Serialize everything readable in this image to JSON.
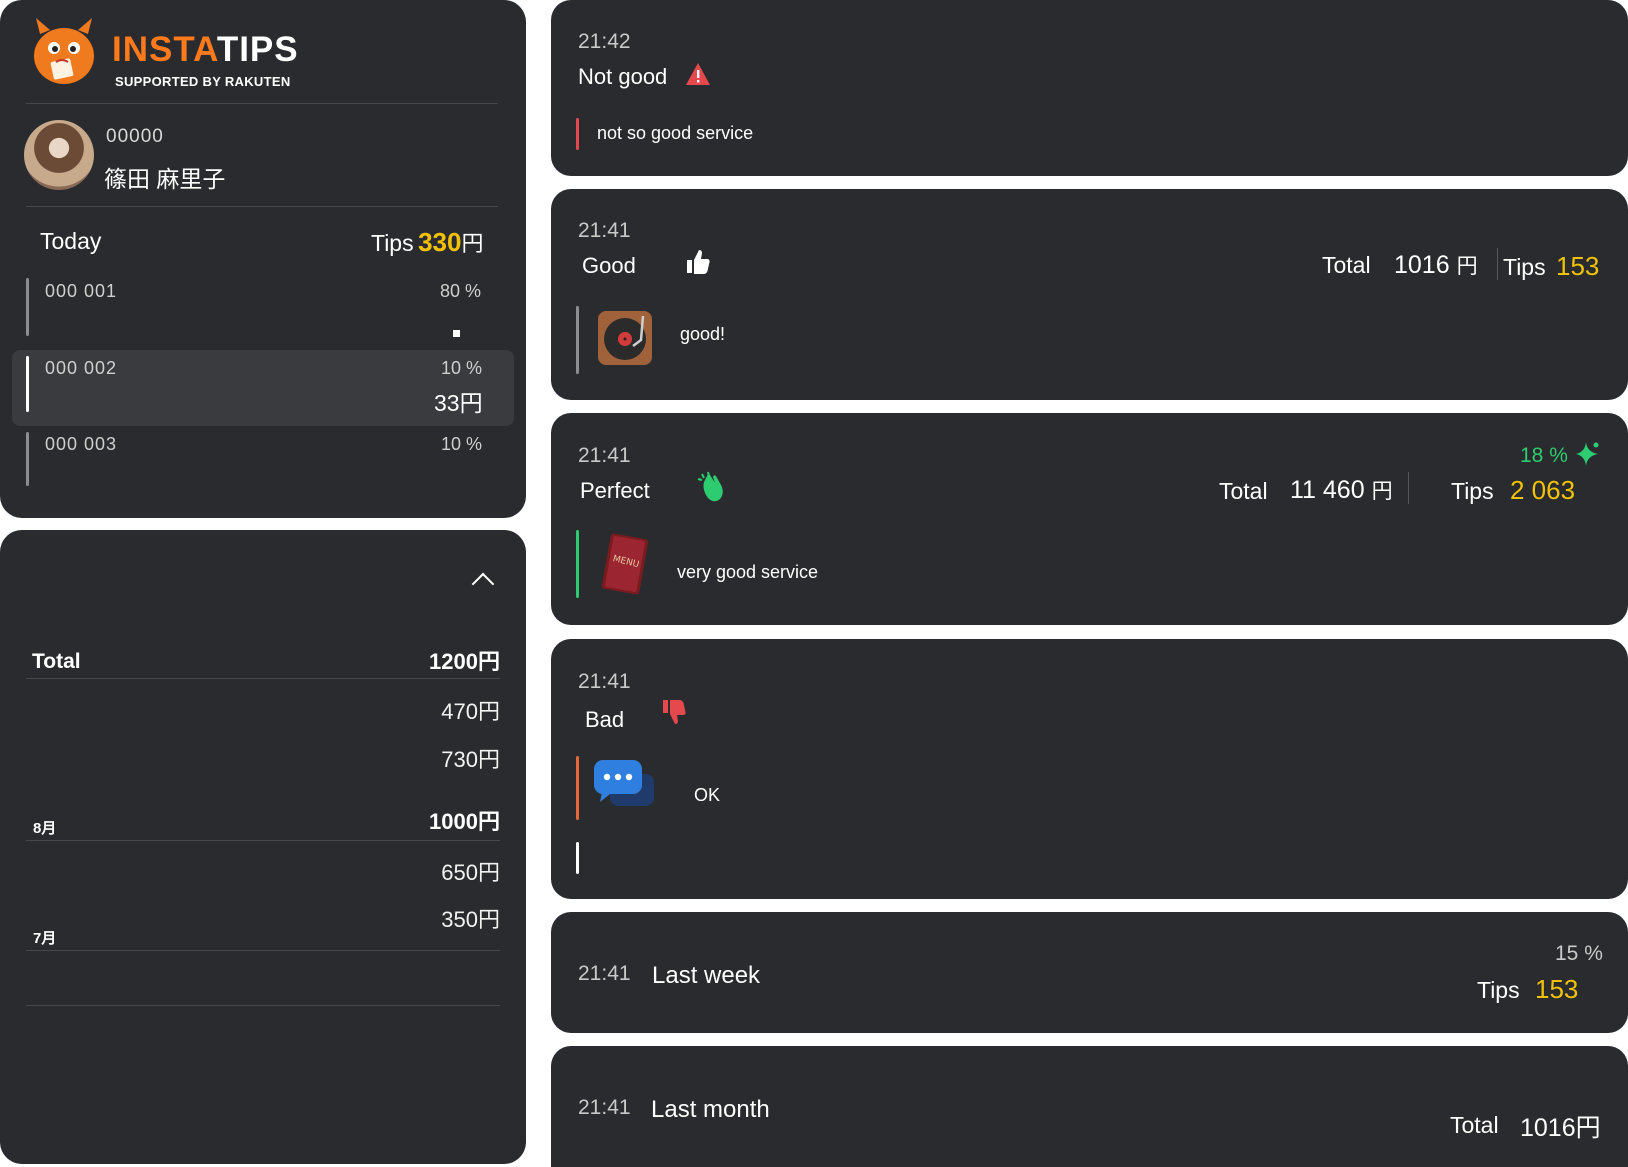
{
  "brand": {
    "name_part1": "INSTA",
    "name_part2": "TIPS",
    "tagline": "SUPPORTED BY RAKUTEN",
    "icon": "mascot-logo"
  },
  "user": {
    "id": "00000",
    "name": "篠田 麻里子",
    "avatar_icon": "user-avatar"
  },
  "today": {
    "label": "Today",
    "tips_label": "Tips",
    "tips_amount": "330",
    "currency": "円",
    "staff": [
      {
        "id": "000 001",
        "percent": "80 %",
        "amount": ""
      },
      {
        "id": "000 002",
        "percent": "10 %",
        "amount": "33円"
      },
      {
        "id": "000 003",
        "percent": "10 %",
        "amount": ""
      }
    ]
  },
  "summary": {
    "total_label": "Total",
    "total_value": "1200円",
    "rows": [
      {
        "value": "470円"
      },
      {
        "value": "730円"
      }
    ],
    "months": [
      {
        "label": "8月",
        "total": "1000円",
        "values": [
          "650円",
          "350円"
        ]
      },
      {
        "label": "7月"
      }
    ]
  },
  "feed": [
    {
      "time": "21:42",
      "rating": "Not good",
      "icon": "warning-icon",
      "comment": "not so good service",
      "accent": "#e5484d"
    },
    {
      "time": "21:41",
      "rating": "Good",
      "icon": "thumbs-up-icon",
      "total_label": "Total",
      "total": "1016",
      "total_currency": "円",
      "tips_label": "Tips",
      "tips": "153",
      "comment": "good!",
      "thumb_icon": "record-player-icon"
    },
    {
      "time": "21:41",
      "rating": "Perfect",
      "icon": "clapping-hands-icon",
      "percent": "18 %",
      "total_label": "Total",
      "total": "11 460",
      "total_currency": "円",
      "tips_label": "Tips",
      "tips": "2 063",
      "comment": "very good service",
      "thumb_icon": "menu-book-icon",
      "accent": "#2ecc71"
    },
    {
      "time": "21:41",
      "rating": "Bad",
      "icon": "thumbs-down-icon",
      "comment": "OK",
      "thumb_icon": "chat-bubbles-icon",
      "accent": "#e8663c"
    },
    {
      "time": "21:41",
      "label": "Last week",
      "percent": "15 %",
      "tips_label": "Tips",
      "tips": "153"
    },
    {
      "time": "21:41",
      "label": "Last month",
      "total_label": "Total",
      "total": "1016円"
    }
  ],
  "colors": {
    "background": "#ffffff",
    "panel": "#2a2b2e",
    "tips": "#f2c200",
    "brand": "#ff7a1a",
    "positive": "#2ecc71"
  }
}
